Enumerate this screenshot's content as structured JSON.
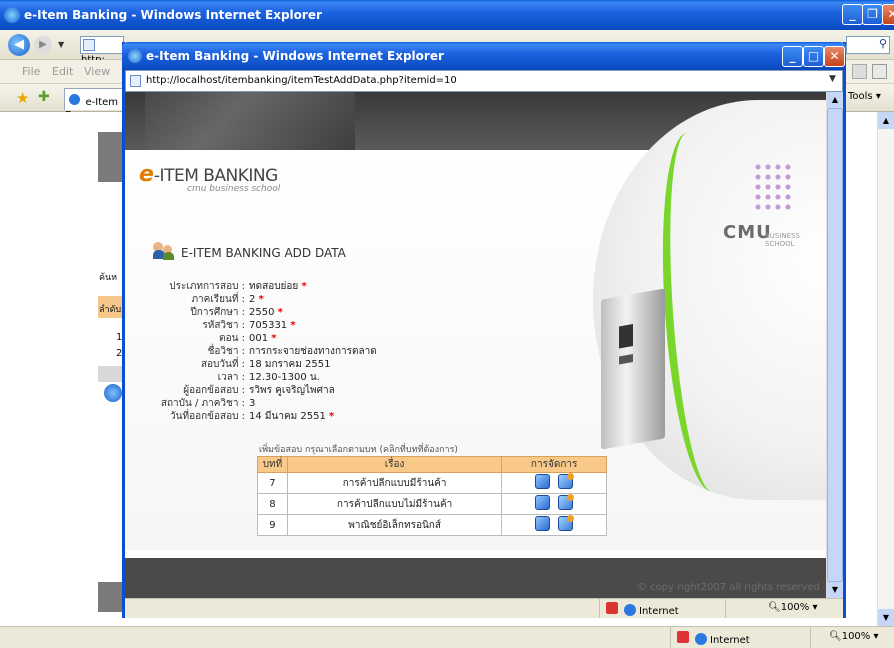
{
  "outer": {
    "title": "e-Item Banking - Windows Internet Explorer",
    "address_partial": "http:",
    "menu": [
      "File",
      "Edit",
      "View"
    ],
    "tab_label": "e-Item B",
    "tools_label": "Tools",
    "side_nav_labels": [
      "ค้นห",
      "ลำดับ",
      "1",
      "2"
    ],
    "status_zone": "Internet",
    "status_zoom": "100%"
  },
  "popup": {
    "title": "e-Item Banking - Windows Internet Explorer",
    "url": "http://localhost/itembanking/itemTestAddData.php?itemid=10",
    "status_zone": "Internet",
    "status_zoom": "100%"
  },
  "page": {
    "logo_e": "e",
    "logo_main": "-ITEM BANKING",
    "logo_sub": "cmu business school",
    "cmu_label": "CMU",
    "cmu_sub": "BUSINESS SCHOOL",
    "section_title": "E-ITEM BANKING ADD DATA",
    "form": [
      {
        "label": "ประเภทการสอบ :",
        "value": "ทดสอบย่อย",
        "required": "*"
      },
      {
        "label": "ภาคเรียนที่ :",
        "value": "2",
        "required": "*"
      },
      {
        "label": "ปีการศึกษา :",
        "value": "2550",
        "required": "*"
      },
      {
        "label": "รหัสวิชา :",
        "value": "705331",
        "required": "*"
      },
      {
        "label": "ตอน :",
        "value": "001",
        "required": "*"
      },
      {
        "label": "ชื่อวิชา :",
        "value": "การกระจายช่องทางการตลาด",
        "required": ""
      },
      {
        "label": "สอบวันที่ :",
        "value": "18 มกราคม 2551",
        "required": ""
      },
      {
        "label": "เวลา :",
        "value": "12.30-1300 น.",
        "required": ""
      },
      {
        "label": "ผู้ออกข้อสอบ :",
        "value": "รวิพร คูเจริญไพศาล",
        "required": ""
      },
      {
        "label": "สถาบัน / ภาควิชา :",
        "value": "3",
        "required": ""
      },
      {
        "label": "วันที่ออกข้อสอบ :",
        "value": "14 มีนาคม 2551",
        "required": "*"
      }
    ],
    "table_caption": "เพิ่มข้อสอบ กรุณาเลือกตามบท (คลิกที่บทที่ต้องการ)",
    "table_headers": [
      "บทที่",
      "เรื่อง",
      "การจัดการ"
    ],
    "rows": [
      {
        "chapter": "7",
        "topic": "การค้าปลีกแบบมีร้านค้า"
      },
      {
        "chapter": "8",
        "topic": "การค้าปลีกแบบไม่มีร้านค้า"
      },
      {
        "chapter": "9",
        "topic": "พาณิชย์อิเล็กทรอนิกส์"
      }
    ],
    "footer": "© copy right2007 all rights reserved"
  },
  "colors": {
    "xp_blue": "#0d4fc6",
    "logo_orange": "#e37a00",
    "header_peach": "#f9c98a",
    "green_stripe": "#7ad62a"
  }
}
